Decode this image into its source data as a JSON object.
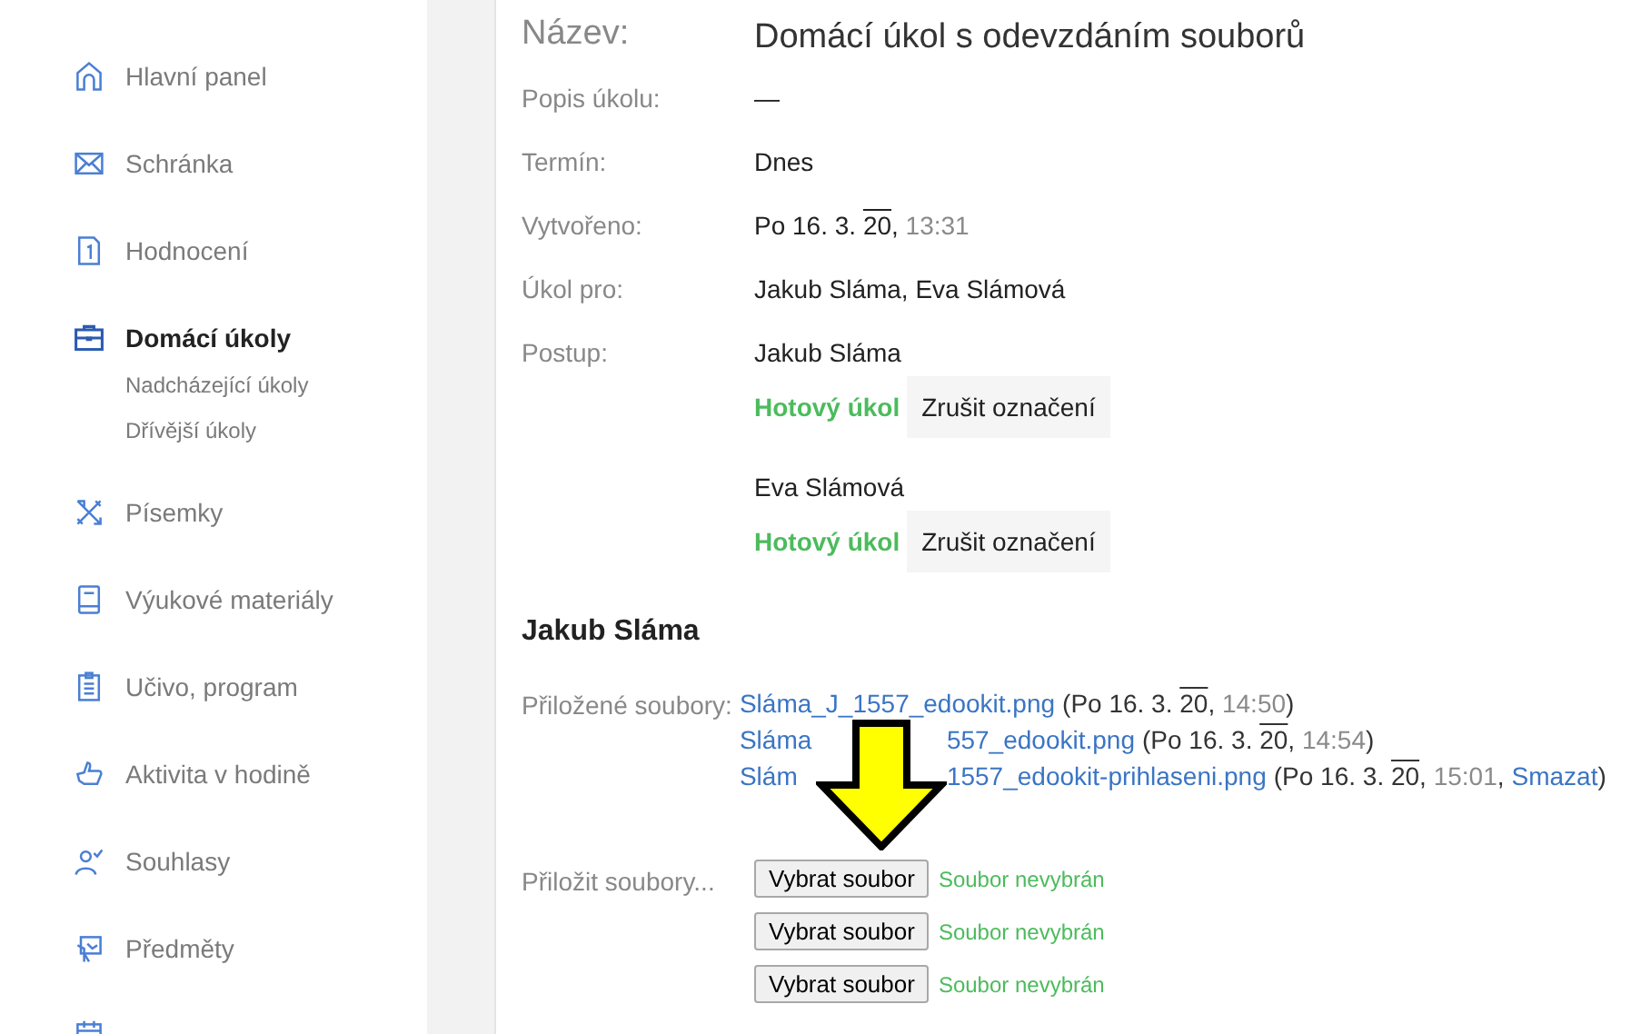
{
  "sidebar": {
    "items": [
      {
        "label": "Hlavní panel",
        "kind": "home",
        "selected": false
      },
      {
        "label": "Schránka",
        "kind": "mail",
        "selected": false
      },
      {
        "label": "Hodnocení",
        "kind": "grade",
        "selected": false
      },
      {
        "label": "Domácí úkoly",
        "kind": "case",
        "selected": true,
        "children": [
          {
            "label": "Nadcházející úkoly"
          },
          {
            "label": "Dřívější úkoly"
          }
        ]
      },
      {
        "label": "Písemky",
        "kind": "tools",
        "selected": false
      },
      {
        "label": "Výukové materiály",
        "kind": "book",
        "selected": false
      },
      {
        "label": "Učivo, program",
        "kind": "clipboard",
        "selected": false
      },
      {
        "label": "Aktivita v hodině",
        "kind": "thumb",
        "selected": false
      },
      {
        "label": "Souhlasy",
        "kind": "person",
        "selected": false
      },
      {
        "label": "Předměty",
        "kind": "board",
        "selected": false
      },
      {
        "kind": "calendar",
        "selected": false
      }
    ]
  },
  "details": [
    {
      "label": "Název:",
      "kind": "title",
      "value": "Domácí úkol s odevzdáním souborů"
    },
    {
      "label": "Popis úkolu:",
      "kind": "text",
      "value": "—"
    },
    {
      "label": "Termín:",
      "kind": "text",
      "value": "Dnes"
    },
    {
      "label": "Vytvořeno:",
      "kind": "date",
      "date": {
        "prefix": "Po 16. 3.",
        "year": "20",
        "sep": ",",
        "time": "13:31"
      }
    },
    {
      "label": "Úkol pro:",
      "kind": "text",
      "value": "Jakub Sláma, Eva Slámová"
    },
    {
      "label": "Postup:",
      "kind": "progress",
      "students": [
        {
          "name": "Jakub Sláma",
          "done": true,
          "status": "Hotový úkol",
          "action": "Zrušit označení"
        },
        {
          "name": "Eva Slámová",
          "done": true,
          "status": "Hotový úkol",
          "action": "Zrušit označení"
        }
      ]
    }
  ],
  "submission": {
    "heading": "Jakub Sláma",
    "attached_label": "Přiložené soubory:",
    "files": [
      {
        "name_start": "Sláma_J_1557_edookit.png",
        "meta": {
          "prefix": "(Po 16. 3.",
          "year": "20",
          "sep": ",",
          "time": "14:50",
          "close": ")"
        }
      },
      {
        "name_start": "Sláma",
        "name_end": "557_edookit.png",
        "meta": {
          "prefix": "(Po 16. 3.",
          "year": "20",
          "sep": ",",
          "time": "14:54",
          "close": ")"
        }
      },
      {
        "name_start": "Slám",
        "name_end": "1557_edookit-prihlaseni.png",
        "meta": {
          "prefix": "(Po 16. 3.",
          "year": "20",
          "sep": ",",
          "time": "15:01",
          "delete_sep": ",",
          "delete": "Smazat",
          "close": ")"
        }
      }
    ],
    "upload_label": "Přiložit soubory...",
    "uploads": [
      {
        "button": "Vybrat soubor",
        "status": "Soubor nevybrán"
      },
      {
        "button": "Vybrat soubor",
        "status": "Soubor nevybrán"
      },
      {
        "button": "Vybrat soubor",
        "status": "Soubor nevybrán"
      }
    ]
  },
  "overlay": {
    "kind": "arrow"
  }
}
